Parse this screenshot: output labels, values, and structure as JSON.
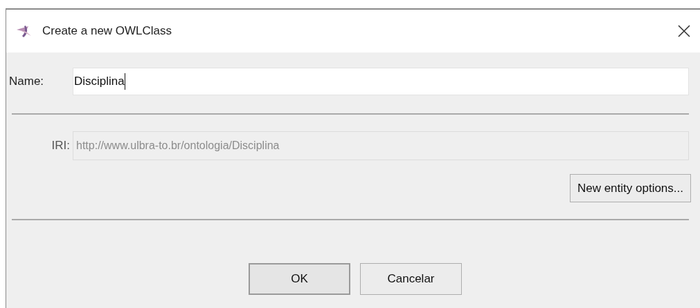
{
  "window": {
    "title": "Create a new OWLClass"
  },
  "name_field": {
    "label": "Name:",
    "value": "Disciplina",
    "focused": true
  },
  "iri_field": {
    "label": "IRI:",
    "value": "http://www.ulbra-to.br/ontologia/Disciplina",
    "disabled": true
  },
  "options_button": {
    "label": "New entity options..."
  },
  "buttons": [
    {
      "label": "OK",
      "default": true
    },
    {
      "label": "Cancelar",
      "default": false
    }
  ]
}
